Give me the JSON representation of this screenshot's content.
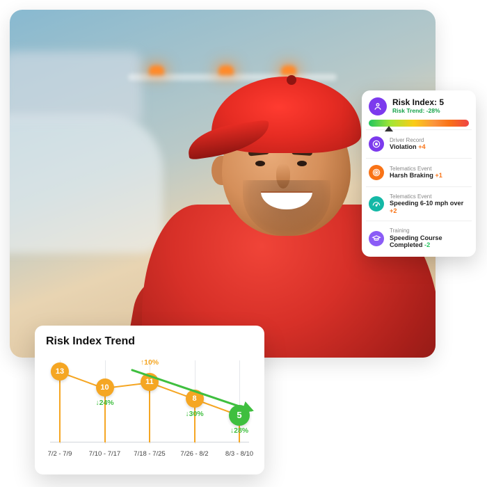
{
  "risk_card": {
    "title": "Risk Index: 5",
    "trend_label": "Risk Trend: ",
    "trend_value": "-28%",
    "gauge_position_pct": 20,
    "items": [
      {
        "icon": "ic-purple",
        "svg": "record",
        "category": "Driver Record",
        "label": "Violation",
        "delta": "+4",
        "delta_class": "delta-pos"
      },
      {
        "icon": "ic-orange",
        "svg": "target",
        "category": "Telematics Event",
        "label": "Harsh Braking",
        "delta": "+1",
        "delta_class": "delta-pos"
      },
      {
        "icon": "ic-teal",
        "svg": "speed",
        "category": "Telematics Event",
        "label": "Speeding 6-10 mph over",
        "delta": "+2",
        "delta_class": "delta-pos"
      },
      {
        "icon": "ic-violet",
        "svg": "grad",
        "category": "Training",
        "label": "Speeding Course Completed",
        "delta": "-2",
        "delta_class": "delta-neg"
      }
    ]
  },
  "trend_card": {
    "title": "Risk Index Trend"
  },
  "chart_data": {
    "type": "line",
    "title": "Risk Index Trend",
    "xlabel": "",
    "ylabel": "",
    "ylim": [
      0,
      15
    ],
    "categories": [
      "7/2 - 7/9",
      "7/10 - 7/17",
      "7/18 - 7/25",
      "7/26 - 8/2",
      "8/3 - 8/10"
    ],
    "series": [
      {
        "name": "Risk Index",
        "values": [
          13,
          10,
          11,
          8,
          5
        ]
      }
    ],
    "point_deltas": [
      {
        "i": 1,
        "text": "24%",
        "dir": "down",
        "color": "green",
        "pos": "below"
      },
      {
        "i": 2,
        "text": "10%",
        "dir": "up",
        "color": "orange",
        "pos": "above"
      },
      {
        "i": 3,
        "text": "30%",
        "dir": "down",
        "color": "green",
        "pos": "below"
      },
      {
        "i": 4,
        "text": "28%",
        "dir": "down",
        "color": "green",
        "pos": "below"
      }
    ],
    "highlight_last": true,
    "trend_arrow": {
      "from_i": 1.6,
      "to_i": 4.3,
      "from_v": 13.5,
      "to_v": 6,
      "color": "#3fbf3f"
    }
  }
}
